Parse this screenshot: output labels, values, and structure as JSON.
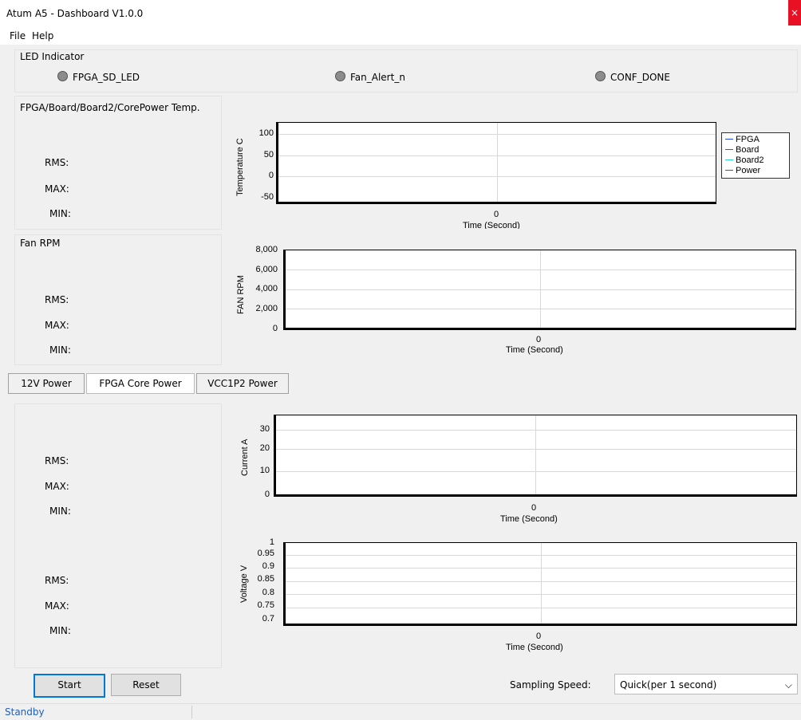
{
  "window": {
    "title": "Atum A5 - Dashboard  V1.0.0",
    "close_glyph": "×"
  },
  "menu": {
    "items": [
      "File",
      "Help"
    ]
  },
  "led_group": {
    "label": "LED Indicator",
    "leds": [
      {
        "label": "FPGA_SD_LED",
        "color": "#8c8c8c"
      },
      {
        "label": "Fan_Alert_n",
        "color": "#8c8c8c"
      },
      {
        "label": "CONF_DONE",
        "color": "#8c8c8c"
      }
    ]
  },
  "temp_group": {
    "label": "FPGA/Board/Board2/CorePower Temp.",
    "rms": "RMS:",
    "max": "MAX:",
    "min": "MIN:"
  },
  "fan_group": {
    "label": "Fan RPM",
    "rms": "RMS:",
    "max": "MAX:",
    "min": "MIN:"
  },
  "power_tabs": {
    "tabs": [
      "12V Power",
      "FPGA Core Power",
      "VCC1P2 Power"
    ],
    "active": 1
  },
  "current_stats": {
    "rms": "RMS:",
    "max": "MAX:",
    "min": "MIN:"
  },
  "voltage_stats": {
    "rms": "RMS:",
    "max": "MAX:",
    "min": "MIN:"
  },
  "controls": {
    "start_label": "Start",
    "reset_label": "Reset",
    "sampling_label": "Sampling Speed:",
    "sampling_value": "Quick(per 1 second)",
    "sampling_arrow": "⌵"
  },
  "status": {
    "text": "Standby"
  },
  "chart_data": [
    {
      "type": "line",
      "ylabel": "Temperature C",
      "xlabel": "Time (Second)",
      "yticks": [
        "100",
        "50",
        "0",
        "-50"
      ],
      "ylim": [
        -50,
        125
      ],
      "xticks": [
        "0"
      ],
      "legend": [
        "FPGA",
        "Board",
        "Board2",
        "Power"
      ],
      "legend_colors": [
        "#1f4fd8",
        "#1a8a1a",
        "#22d3d3",
        "#8b3a62"
      ],
      "legend_position": "right",
      "series": []
    },
    {
      "type": "line",
      "ylabel": "FAN RPM",
      "xlabel": "Time (Second)",
      "yticks": [
        "8,000",
        "6,000",
        "4,000",
        "2,000",
        "0"
      ],
      "ylim": [
        0,
        8000
      ],
      "xticks": [
        "0"
      ],
      "series": []
    },
    {
      "type": "line",
      "ylabel": "Current A",
      "xlabel": "Time (Second)",
      "yticks": [
        "30",
        "20",
        "10",
        "0"
      ],
      "ylim": [
        0,
        35
      ],
      "xticks": [
        "0"
      ],
      "series": []
    },
    {
      "type": "line",
      "ylabel": "Voltage V",
      "xlabel": "Time (Second)",
      "yticks": [
        "1",
        "0.95",
        "0.9",
        "0.85",
        "0.8",
        "0.75",
        "0.7"
      ],
      "ylim": [
        0.7,
        1
      ],
      "xticks": [
        "0"
      ],
      "series": []
    }
  ]
}
